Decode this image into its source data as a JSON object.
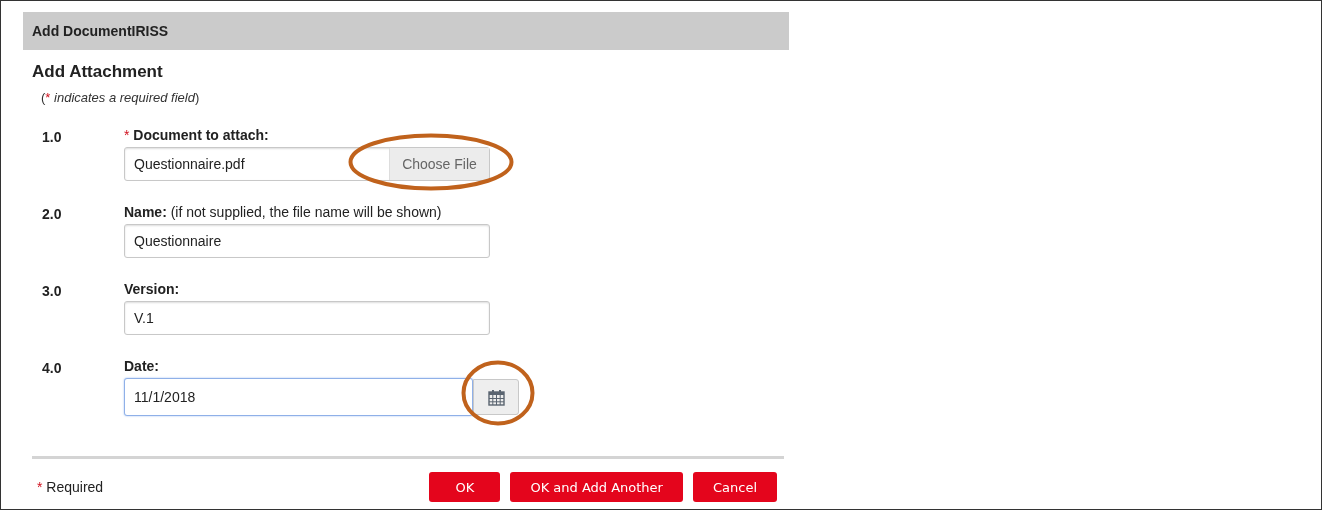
{
  "dialog": {
    "title": "Add DocumentIRISS"
  },
  "section_title": "Add Attachment",
  "note": {
    "open": "(",
    "mark": "*",
    "text": "indicates a required field",
    "close": ")"
  },
  "fields": [
    {
      "kind": "file",
      "number": "1.0",
      "required_mark": "*",
      "label": "Document to attach:",
      "value": "Questionnaire.pdf",
      "button": {
        "label": "Choose File",
        "circled": true
      },
      "focused": false
    },
    {
      "kind": "text",
      "number": "2.0",
      "label": "Name:",
      "hint": "(if not supplied, the file name will be shown)",
      "value": "Questionnaire",
      "focused": false
    },
    {
      "kind": "text",
      "number": "3.0",
      "label": "Version:",
      "value": "V.1",
      "focused": false
    },
    {
      "kind": "date",
      "number": "4.0",
      "label": "Date:",
      "value": "11/1/2018",
      "button": {
        "circled": true
      },
      "focused": true
    }
  ],
  "footer": {
    "mark": "*",
    "text": "Required"
  },
  "buttons": [
    "OK",
    "OK and Add Another",
    "Cancel"
  ]
}
